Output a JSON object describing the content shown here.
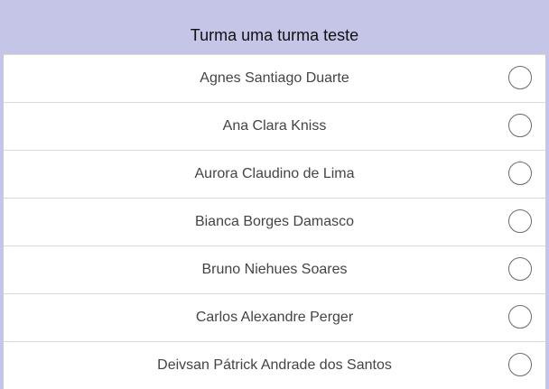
{
  "header": {
    "title": "Turma uma turma teste"
  },
  "students": [
    {
      "name": "Agnes Santiago Duarte",
      "checked": false
    },
    {
      "name": "Ana Clara Kniss",
      "checked": false
    },
    {
      "name": "Aurora Claudino de Lima",
      "checked": false
    },
    {
      "name": "Bianca Borges Damasco",
      "checked": false
    },
    {
      "name": "Bruno Niehues Soares",
      "checked": false
    },
    {
      "name": "Carlos Alexandre Perger",
      "checked": false
    },
    {
      "name": "Deivsan Pátrick Andrade dos Santos",
      "checked": false
    }
  ],
  "colors": {
    "header_background": "#c5c5e7",
    "list_background": "#ffffff",
    "divider": "#d9d9d9",
    "radio_border": "#6b6b6b"
  }
}
